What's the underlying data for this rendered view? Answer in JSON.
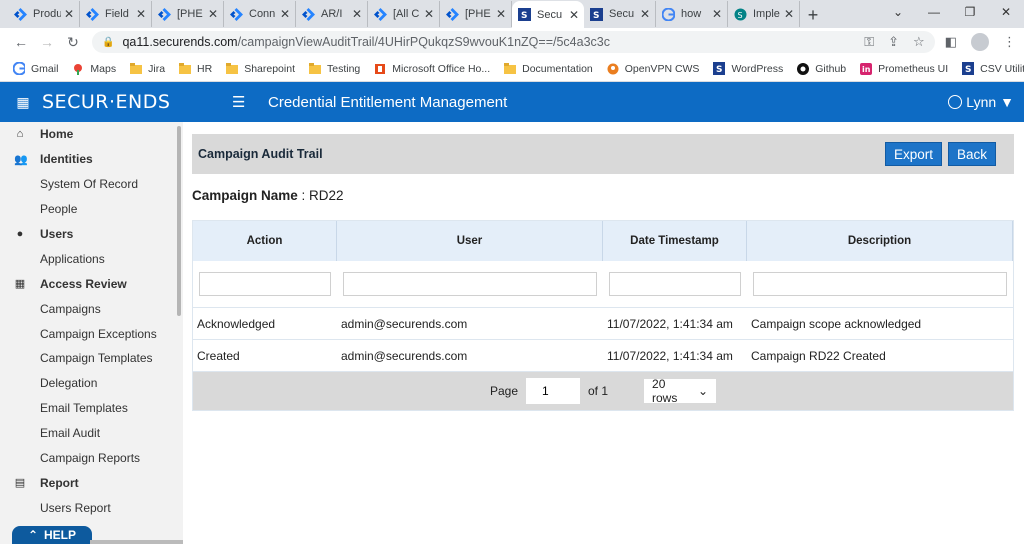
{
  "browser": {
    "tabs": [
      {
        "title": "Produ",
        "icon": "jira-icon"
      },
      {
        "title": "Field",
        "icon": "jira-icon"
      },
      {
        "title": "[PHE",
        "icon": "jira-icon"
      },
      {
        "title": "Conn",
        "icon": "jira-icon"
      },
      {
        "title": "AR/I",
        "icon": "jira-icon"
      },
      {
        "title": "[All C",
        "icon": "jira-icon"
      },
      {
        "title": "[PHE",
        "icon": "jira-icon"
      },
      {
        "title": "Secu",
        "icon": "securends-icon"
      },
      {
        "title": "Secu",
        "icon": "securends-icon"
      },
      {
        "title": "how",
        "icon": "google-icon"
      },
      {
        "title": "Imple",
        "icon": "sharepoint-icon"
      }
    ],
    "url_host": "qa11.securends.com",
    "url_path": "/campaignViewAuditTrail/4UHirPQukqzS9wvouK1nZQ==/5c4a3c3c",
    "bookmarks": [
      {
        "label": "Gmail",
        "icon": "google-icon"
      },
      {
        "label": "Maps",
        "icon": "maps-icon"
      },
      {
        "label": "Jira",
        "icon": "folder-icon"
      },
      {
        "label": "HR",
        "icon": "folder-icon"
      },
      {
        "label": "Sharepoint",
        "icon": "folder-icon"
      },
      {
        "label": "Testing",
        "icon": "folder-icon"
      },
      {
        "label": "Microsoft Office Ho...",
        "icon": "office-icon"
      },
      {
        "label": "Documentation",
        "icon": "folder-icon"
      },
      {
        "label": "OpenVPN CWS",
        "icon": "openvpn-icon"
      },
      {
        "label": "WordPress",
        "icon": "securends-icon"
      },
      {
        "label": "Github",
        "icon": "github-icon"
      },
      {
        "label": "Prometheus UI",
        "icon": "prometheus-icon"
      },
      {
        "label": "CSV Utility",
        "icon": "securends-icon"
      }
    ],
    "bookmarks_more": "»"
  },
  "app": {
    "logo": "SECUR·ENDS",
    "title": "Credential Entitlement Management",
    "user": "Lynn",
    "brand_color": "#0d6bc4"
  },
  "sidebar": {
    "items": [
      {
        "label": "Home",
        "type": "top",
        "icon": "home-icon"
      },
      {
        "label": "Identities",
        "type": "top",
        "icon": "people-icon"
      },
      {
        "label": "System Of Record",
        "type": "sub"
      },
      {
        "label": "People",
        "type": "sub"
      },
      {
        "label": "Users",
        "type": "top",
        "icon": "user-icon"
      },
      {
        "label": "Applications",
        "type": "sub"
      },
      {
        "label": "Access Review",
        "type": "top",
        "icon": "grid-icon"
      },
      {
        "label": "Campaigns",
        "type": "sub"
      },
      {
        "label": "Campaign Exceptions",
        "type": "sub"
      },
      {
        "label": "Campaign Templates",
        "type": "sub"
      },
      {
        "label": "Delegation",
        "type": "sub"
      },
      {
        "label": "Email Templates",
        "type": "sub"
      },
      {
        "label": "Email Audit",
        "type": "sub"
      },
      {
        "label": "Campaign Reports",
        "type": "sub"
      },
      {
        "label": "Report",
        "type": "top",
        "icon": "document-icon"
      },
      {
        "label": "Users Report",
        "type": "sub"
      }
    ],
    "help": "HELP"
  },
  "panel": {
    "title": "Campaign Audit Trail",
    "export": "Export",
    "back": "Back",
    "campaign_label": "Campaign Name",
    "campaign_value": ": RD22"
  },
  "table": {
    "columns": [
      "Action",
      "User",
      "Date Timestamp",
      "Description"
    ],
    "rows": [
      [
        "Acknowledged",
        "admin@securends.com",
        "11/07/2022, 1:41:34 am",
        "Campaign scope acknowledged"
      ],
      [
        "Created",
        "admin@securends.com",
        "11/07/2022, 1:41:34 am",
        "Campaign RD22 Created"
      ]
    ],
    "pager": {
      "page_label": "Page",
      "page_value": "1",
      "of_label": "of 1",
      "rows_option": "20 rows"
    }
  }
}
